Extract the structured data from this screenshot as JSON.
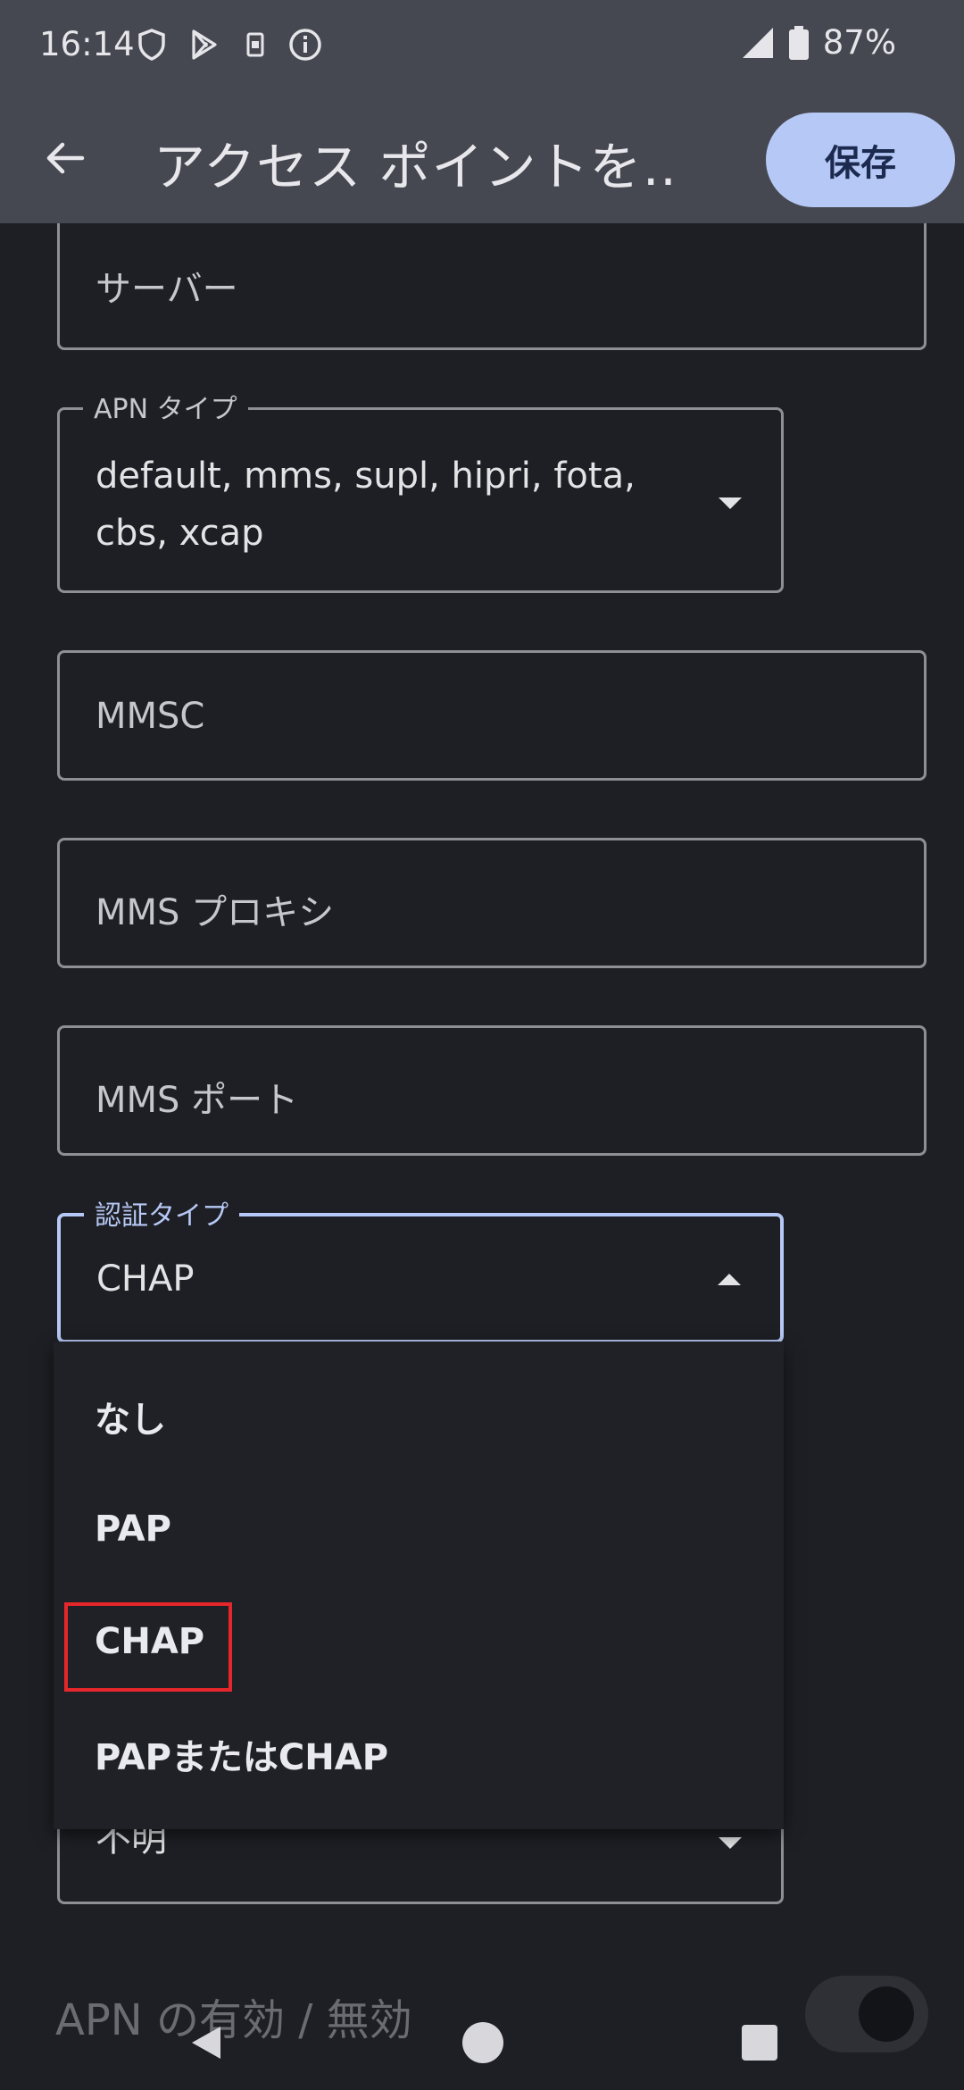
{
  "status_bar": {
    "time": "16:14",
    "battery": "87%",
    "icons": [
      "shield-icon",
      "play-store-icon",
      "sim-card-icon",
      "info-icon",
      "signal-icon",
      "battery-icon"
    ]
  },
  "app_bar": {
    "title": "アクセス ポイントを…",
    "save_label": "保存"
  },
  "fields": {
    "server": {
      "placeholder": "サーバー"
    },
    "apn_type": {
      "label": "APN タイプ",
      "value_line1": "default, mms, supl, hipri, fota,",
      "value_line2": "cbs, xcap"
    },
    "mmsc": {
      "placeholder": "MMSC"
    },
    "mms_proxy": {
      "placeholder": "MMS プロキシ"
    },
    "mms_port": {
      "placeholder": "MMS ポート"
    },
    "auth_type": {
      "label": "認証タイプ",
      "value": "CHAP"
    },
    "hidden_field": {
      "value": "不明"
    }
  },
  "auth_menu": {
    "options": [
      "なし",
      "PAP",
      "CHAP",
      "PAPまたはCHAP"
    ],
    "highlighted": "CHAP"
  },
  "apn_toggle": {
    "label": "APN の有効 / 無効"
  },
  "colors": {
    "accent": "#b6c8f5",
    "highlight_box": "#e5262a",
    "background": "#1e1f24",
    "appbar": "#464851"
  }
}
